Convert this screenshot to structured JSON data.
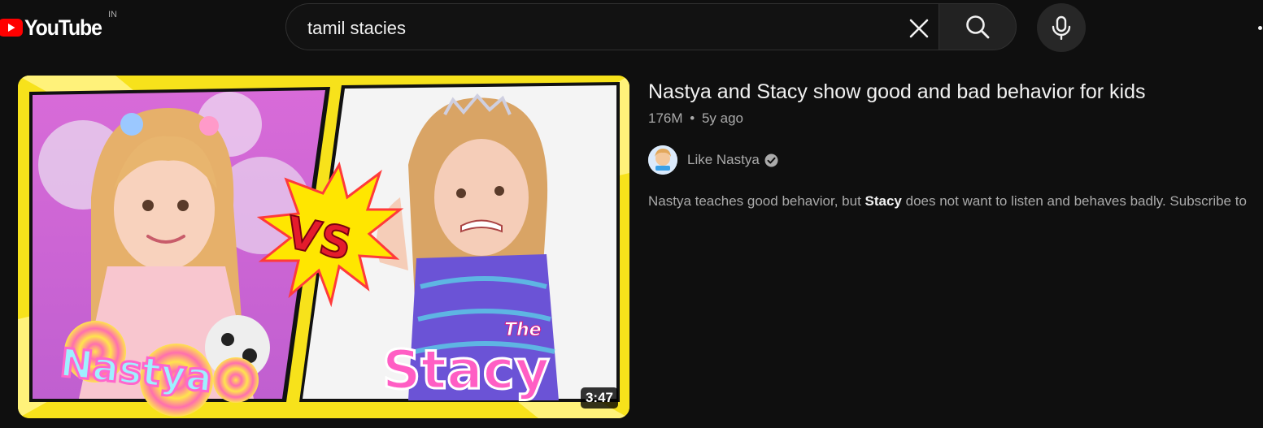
{
  "header": {
    "logo_text": "YouTube",
    "country_code": "IN",
    "search": {
      "value": "tamil stacies"
    }
  },
  "result": {
    "title": "Nastya and Stacy show good and bad behavior for kids",
    "views": "176M",
    "separator": "•",
    "age": "5y ago",
    "channel": "Like Nastya",
    "description_before": "Nastya teaches good behavior, but ",
    "description_highlight": "Stacy",
    "description_after": " does not want to listen and behaves badly. Subscribe to",
    "duration": "3:47",
    "thumbnail_text": {
      "left_name": "Nastya",
      "vs": "VS",
      "the": "The",
      "right_name": "Stacy"
    }
  },
  "colors": {
    "background": "#0f0f0f",
    "brand_red": "#ff0000",
    "thumb_border": "#f7e21b"
  }
}
